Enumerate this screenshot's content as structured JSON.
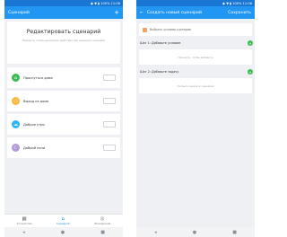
{
  "left": {
    "status_text": "◉ ▼ ▮ 100% 11:06",
    "appbar_title": "Сценарий",
    "hero_title": "Редактировать сценарий",
    "hero_subtitle": "Нажмите, чтобы выполнить действия или изменить сценарий",
    "scenarios": [
      {
        "label": "Проснуться дома",
        "color": "#3cba54",
        "icon": "house-icon",
        "glyph": "⌂"
      },
      {
        "label": "Выход из дома",
        "color": "#f6b93b",
        "icon": "briefcase-icon",
        "glyph": "▭"
      },
      {
        "label": "Доброе утро",
        "color": "#29b6f6",
        "icon": "sunrise-icon",
        "glyph": "☁"
      },
      {
        "label": "Доброй ночи",
        "color": "#b39ddb",
        "icon": "moon-icon",
        "glyph": "☾"
      }
    ],
    "tabs": [
      {
        "label": "Устройства",
        "icon": "devices-icon",
        "glyph": "▦"
      },
      {
        "label": "Сценарий",
        "icon": "home-icon",
        "glyph": "⌂"
      },
      {
        "label": "Расширения",
        "icon": "extensions-icon",
        "glyph": "◎"
      }
    ]
  },
  "right": {
    "status_text": "◉ ▼ ▮ 100% 11:06",
    "appbar_title": "Создать новый сценарий",
    "appbar_action": "Сохранить",
    "add_condition": "Выбрать условия сценария",
    "sections": [
      {
        "label": "Шаг 1: Добавьте условие",
        "placeholder": "Нажмите, чтобы добавить"
      },
      {
        "label": "Шаг 2: Добавьте задачу",
        "placeholder": "Не было задачи в сценарии"
      }
    ]
  },
  "nav_glyphs": [
    "◂",
    "●",
    "■"
  ],
  "accent_color": "#2196f3"
}
